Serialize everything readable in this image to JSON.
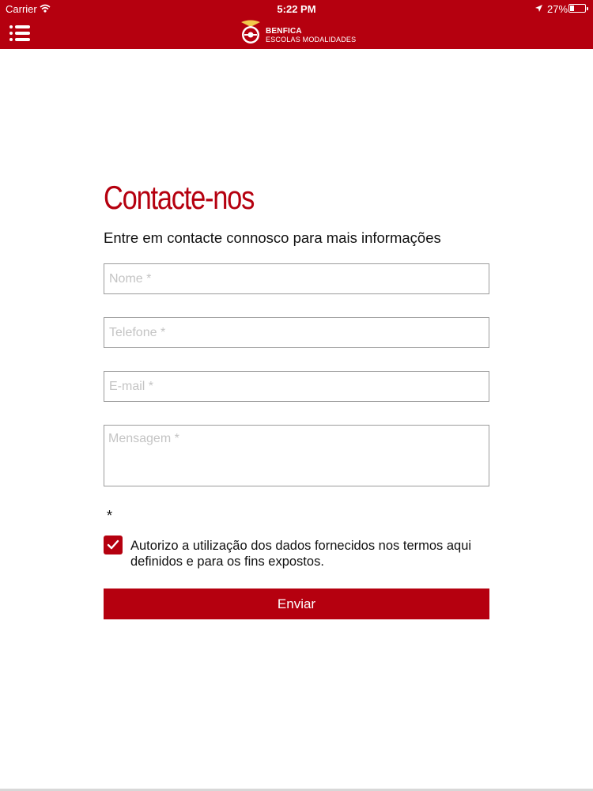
{
  "status_bar": {
    "carrier": "Carrier",
    "time": "5:22 PM",
    "battery": "27%"
  },
  "header": {
    "menu_icon": "menu-icon",
    "brand_name": "BENFICA",
    "brand_subtitle": "ESCOLAS MODALIDADES",
    "logo_icon": "benfica-crest-icon"
  },
  "main": {
    "title": "Contacte-nos",
    "subtitle": "Entre em contacte connosco para mais informações",
    "fields": {
      "name_placeholder": "Nome *",
      "phone_placeholder": "Telefone *",
      "email_placeholder": "E-mail *",
      "message_placeholder": "Mensagem *"
    },
    "required_marker": "*",
    "consent_checked": true,
    "consent_text": "Autorizo a utilização dos dados fornecidos nos termos aqui definidos e para os fins expostos.",
    "submit_label": "Enviar"
  },
  "colors": {
    "brand_red": "#b5000f",
    "text": "#111111",
    "border": "#9b9b9b"
  }
}
